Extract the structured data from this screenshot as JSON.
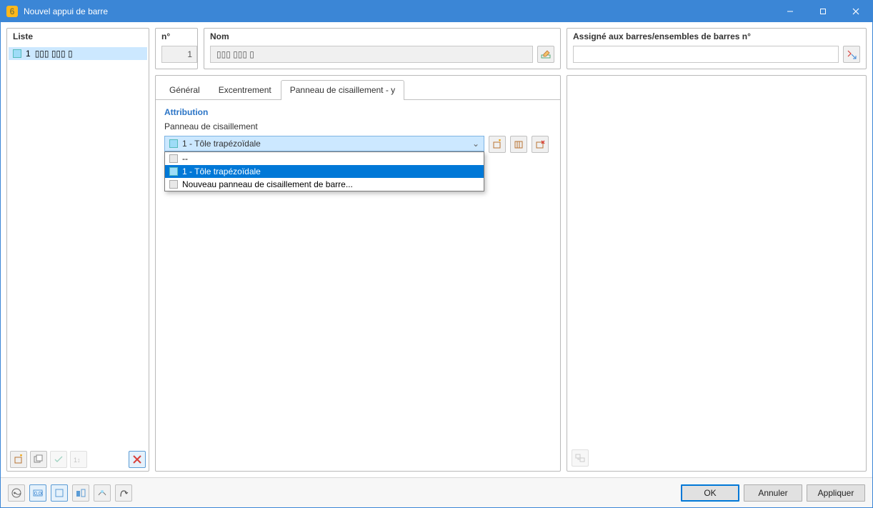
{
  "window": {
    "title": "Nouvel appui de barre",
    "app_icon_char": "6"
  },
  "left": {
    "title": "Liste",
    "items": [
      {
        "num": "1",
        "label": "▯▯▯ ▯▯▯ ▯"
      }
    ]
  },
  "header": {
    "num_label": "n°",
    "num_value": "1",
    "nom_label": "Nom",
    "nom_value": "▯▯▯ ▯▯▯ ▯",
    "assign_label": "Assigné aux barres/ensembles de barres n°",
    "assign_value": ""
  },
  "tabs": {
    "general": "Général",
    "excentrement": "Excentrement",
    "panneau": "Panneau de cisaillement - y"
  },
  "attribution": {
    "section_title": "Attribution",
    "field_label": "Panneau de cisaillement",
    "selected": "1 - Tôle trapézoïdale",
    "options": [
      "--",
      "1 - Tôle trapézoïdale",
      "Nouveau panneau de cisaillement de barre..."
    ]
  },
  "buttons": {
    "ok": "OK",
    "cancel": "Annuler",
    "apply": "Appliquer"
  }
}
